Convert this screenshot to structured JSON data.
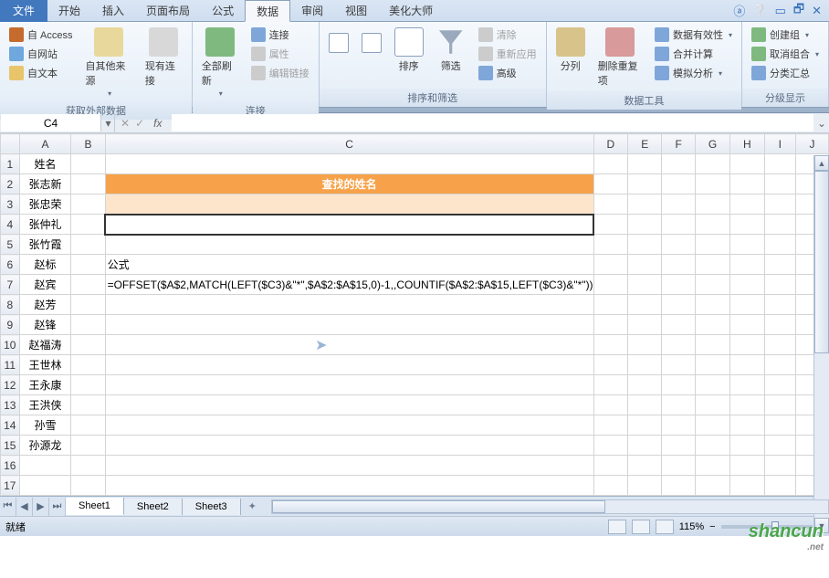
{
  "tabs": {
    "file": "文件",
    "items": [
      "开始",
      "插入",
      "页面布局",
      "公式",
      "数据",
      "审阅",
      "视图",
      "美化大师"
    ],
    "active_index": 4
  },
  "ribbon": {
    "group1": {
      "access": "自 Access",
      "web": "自网站",
      "text": "自文本",
      "other": "自其他来源",
      "existing": "现有连接",
      "label": "获取外部数据"
    },
    "group2": {
      "refresh": "全部刷新",
      "conn": "连接",
      "prop": "属性",
      "editlinks": "编辑链接",
      "label": "连接"
    },
    "group3": {
      "sort": "排序",
      "filter": "筛选",
      "clear": "清除",
      "reapply": "重新应用",
      "advanced": "高级",
      "label": "排序和筛选"
    },
    "group4": {
      "textcol": "分列",
      "dedupe": "删除重复项",
      "validate": "数据有效性",
      "consolidate": "合并计算",
      "whatif": "模拟分析",
      "label": "数据工具"
    },
    "group5": {
      "groupbtn": "创建组",
      "ungroup": "取消组合",
      "subtotal": "分类汇总",
      "label": "分级显示"
    }
  },
  "namebox": {
    "value": "C4",
    "fx": "fx"
  },
  "columns": [
    "A",
    "B",
    "C",
    "D",
    "E",
    "F",
    "G",
    "H",
    "I",
    "J"
  ],
  "rows": {
    "count": 17,
    "colA": [
      "姓名",
      "张志新",
      "张忠荣",
      "张仲礼",
      "张竹霞",
      "赵标",
      "赵宾",
      "赵芳",
      "赵锋",
      "赵福涛",
      "王世林",
      "王永康",
      "王洪侠",
      "孙雪",
      "孙源龙",
      "",
      ""
    ],
    "c2": "查找的姓名",
    "c6": "公式",
    "c7": "=OFFSET($A$2,MATCH(LEFT($C3)&\"*\",$A$2:$A$15,0)-1,,COUNTIF($A$2:$A$15,LEFT($C3)&\"*\"))"
  },
  "sheets": {
    "items": [
      "Sheet1",
      "Sheet2",
      "Sheet3"
    ],
    "active": 0,
    "add": "⁺"
  },
  "status": {
    "ready": "就绪",
    "zoom": "115%"
  },
  "watermark": {
    "text": "shancun",
    "sub": ".net"
  }
}
